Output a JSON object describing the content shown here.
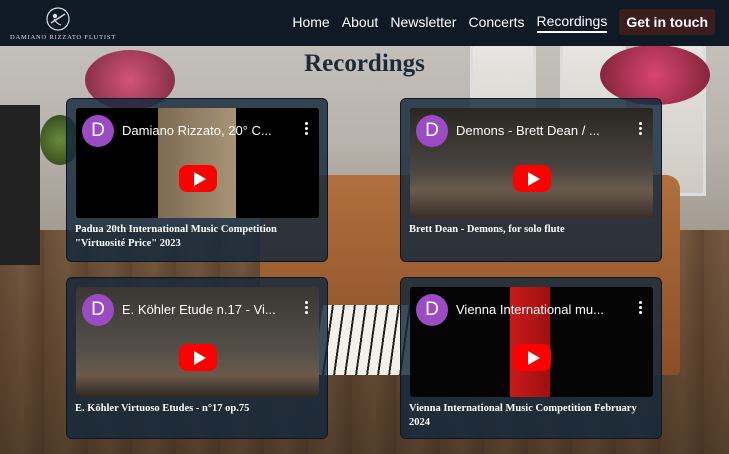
{
  "brand": {
    "name": "DAMIANO RIZZATO FLUTIST",
    "logo": "flutist-logo-icon"
  },
  "nav": {
    "items": [
      {
        "label": "Home"
      },
      {
        "label": "About"
      },
      {
        "label": "Newsletter"
      },
      {
        "label": "Concerts"
      },
      {
        "label": "Recordings",
        "active": true
      }
    ],
    "cta_label": "Get in touch"
  },
  "page": {
    "title": "Recordings"
  },
  "colors": {
    "header_bg": "#0f1a26",
    "card_bg": "#14283c",
    "youtube_red": "#ff0000",
    "avatar": "#9b4cc4",
    "cta_bg": "#3a1e1e"
  },
  "recordings": [
    {
      "video_title": "Damiano Rizzato, 20° C...",
      "avatar_letter": "D",
      "caption": "Padua 20th International Music Competition \"Virtuosité Price\" 2023"
    },
    {
      "video_title": "Demons - Brett Dean / ...",
      "avatar_letter": "D",
      "caption": "Brett Dean - Demons, for solo flute"
    },
    {
      "video_title": "E. Köhler Etude n.17 - Vi...",
      "avatar_letter": "D",
      "caption": "E. Köhler Virtuoso Etudes - n°17 op.75"
    },
    {
      "video_title": "Vienna International mu...",
      "avatar_letter": "D",
      "caption": "Vienna International Music Competition February 2024"
    }
  ]
}
